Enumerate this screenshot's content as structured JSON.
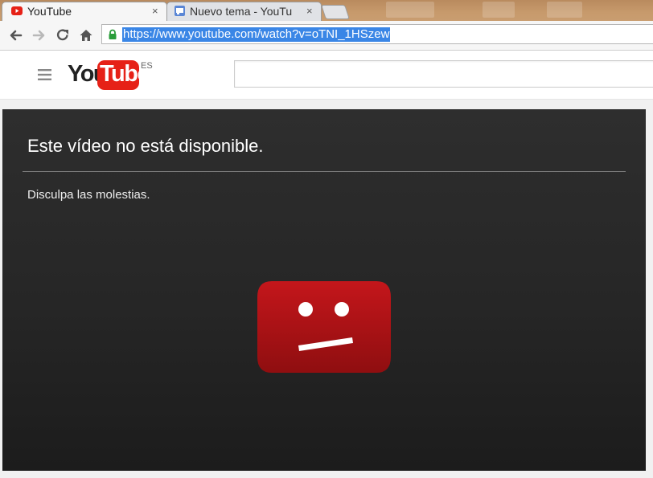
{
  "browser": {
    "tabs": [
      {
        "title": "YouTube",
        "close": "×",
        "active": true
      },
      {
        "title": "Nuevo tema - YouTu",
        "close": "×",
        "active": false
      }
    ],
    "url": "https://www.youtube.com/watch?v=oTNI_1HSzew",
    "nav_icons": [
      "back-icon",
      "forward-icon",
      "reload-icon",
      "home-icon",
      "lock-icon"
    ]
  },
  "masthead": {
    "logo_you": "You",
    "logo_tube": "Tube",
    "region": "ES",
    "search_placeholder": ""
  },
  "error": {
    "title": "Este vídeo no está disponible.",
    "subtitle": "Disculpa las molestias."
  },
  "colors": {
    "youtube_red": "#e62117",
    "url_highlight": "#3a86e6",
    "player_bg": "#262626",
    "sad_face_red": "#cc181e"
  }
}
